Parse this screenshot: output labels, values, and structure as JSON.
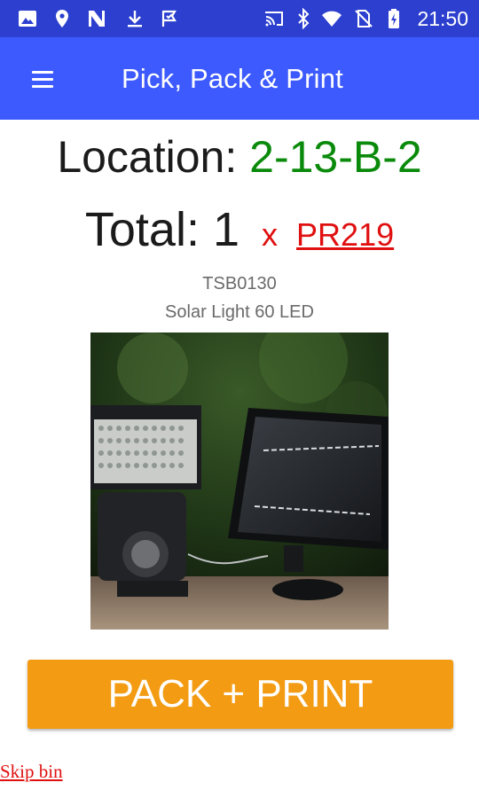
{
  "status_bar": {
    "time": "21:50",
    "icons": [
      "image-icon",
      "location-pin-icon",
      "n-badge-icon",
      "download-icon",
      "check-flag-icon",
      "cast-icon",
      "bluetooth-icon",
      "wifi-icon",
      "no-sim-icon",
      "battery-icon"
    ]
  },
  "app_bar": {
    "title": "Pick, Pack & Print",
    "menu_icon": "hamburger-menu-icon"
  },
  "pick": {
    "location_label": "Location:",
    "location_value": "2-13-B-2",
    "total_label": "Total:",
    "total_value": "1",
    "multiplier": "x",
    "order_ref": "PR219",
    "product_code": "TSB0130",
    "product_name": "Solar Light 60 LED"
  },
  "actions": {
    "pack_print_label": "PACK + PRINT",
    "skip_label": "Skip bin"
  },
  "colors": {
    "status_bar": "#2c3fcf",
    "app_bar": "#3d5afe",
    "location_value": "#0a8a0a",
    "accent_red": "#e01010",
    "button": "#f39b12"
  }
}
